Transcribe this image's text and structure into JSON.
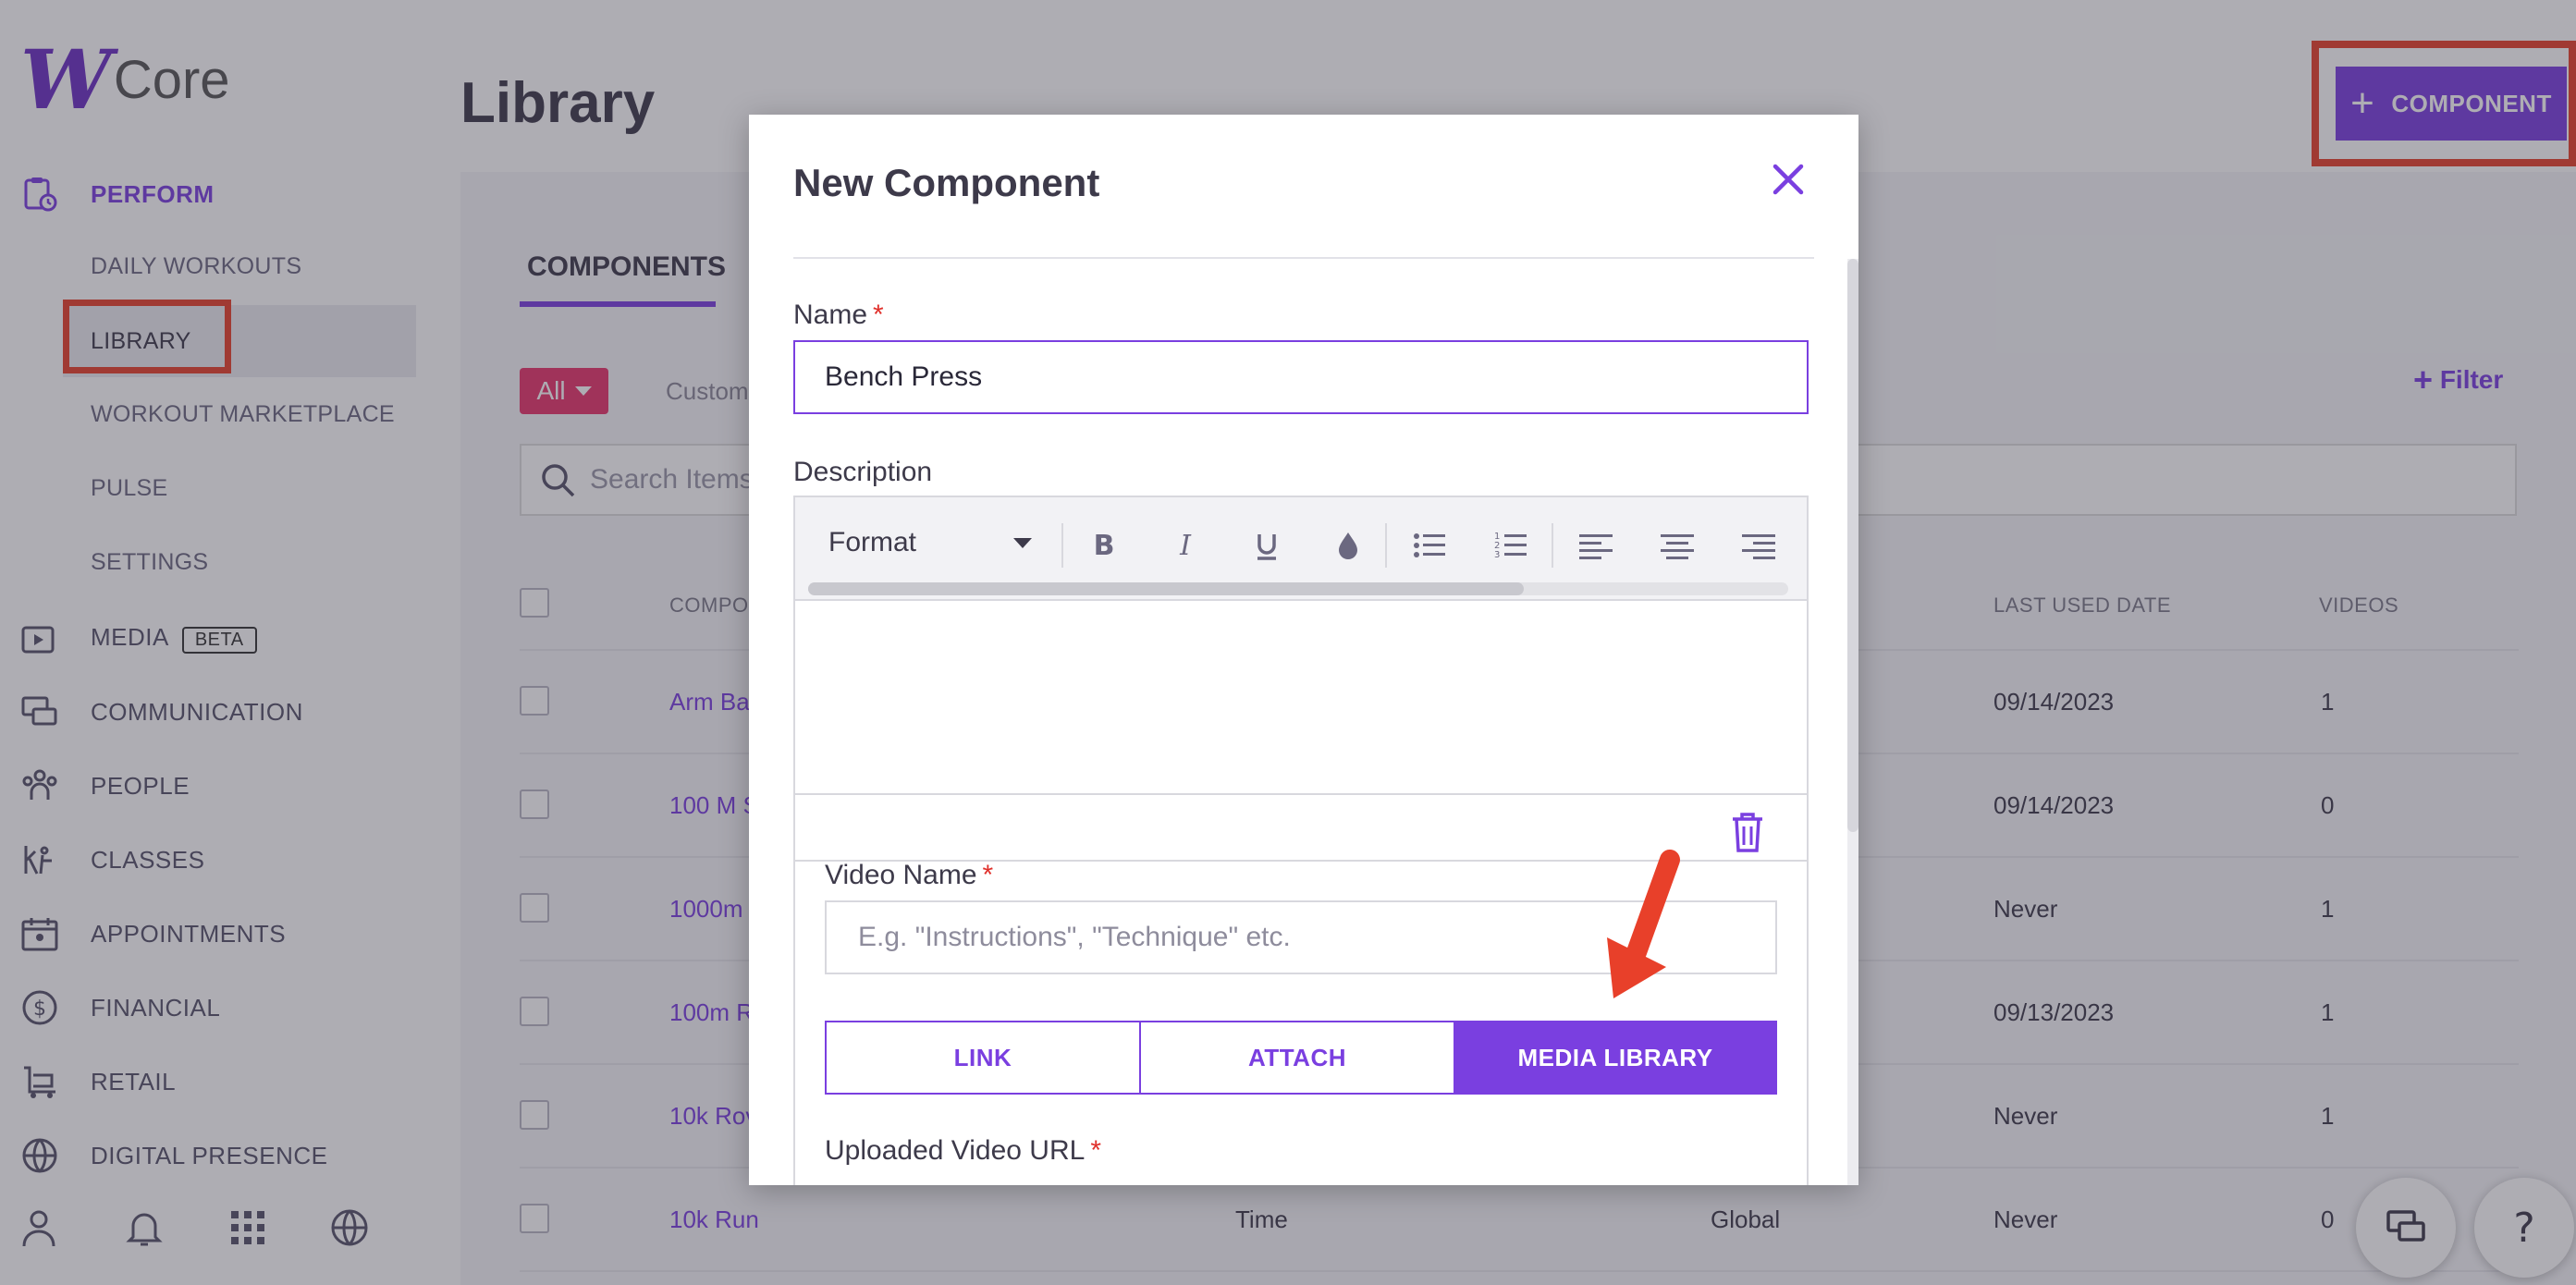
{
  "app": {
    "logo_letter": "W",
    "logo_text": "Core",
    "page_title": "Library"
  },
  "sidebar": {
    "sections": [
      {
        "icon": "clipboard-clock-icon",
        "label": "PERFORM",
        "active": true
      },
      {
        "icon": "media-icon",
        "label": "MEDIA",
        "badge": "BETA"
      },
      {
        "icon": "communication-icon",
        "label": "COMMUNICATION"
      },
      {
        "icon": "people-icon",
        "label": "PEOPLE"
      },
      {
        "icon": "classes-icon",
        "label": "CLASSES"
      },
      {
        "icon": "calendar-icon",
        "label": "APPOINTMENTS"
      },
      {
        "icon": "dollar-icon",
        "label": "FINANCIAL"
      },
      {
        "icon": "cart-icon",
        "label": "RETAIL"
      },
      {
        "icon": "globe-icon",
        "label": "DIGITAL PRESENCE"
      }
    ],
    "sub_items": [
      "DAILY WORKOUTS",
      "LIBRARY",
      "WORKOUT MARKETPLACE",
      "PULSE",
      "SETTINGS"
    ],
    "selected_sub": "LIBRARY",
    "bottom_icons": [
      "user-icon",
      "bell-icon",
      "apps-grid-icon",
      "globe-icon"
    ]
  },
  "header": {
    "add_component_label": "COMPONENT",
    "add_icon": "plus-icon"
  },
  "library": {
    "tab_label": "COMPONENTS",
    "filter_all": "All",
    "custom_label": "Custom",
    "filter_label": "Filter",
    "search_placeholder": "Search Items",
    "columns": [
      "COMPON",
      "LAST USED DATE",
      "VIDEOS"
    ],
    "rows": [
      {
        "name": "Arm Ba",
        "type": "",
        "scope": "",
        "last_used": "09/14/2023",
        "videos": "1"
      },
      {
        "name": "100 M S",
        "type": "",
        "scope": "",
        "last_used": "09/14/2023",
        "videos": "0"
      },
      {
        "name": "1000m",
        "type": "",
        "scope": "",
        "last_used": "Never",
        "videos": "1"
      },
      {
        "name": "100m R",
        "type": "",
        "scope": "",
        "last_used": "09/13/2023",
        "videos": "1"
      },
      {
        "name": "10k Rov",
        "type": "",
        "scope": "",
        "last_used": "Never",
        "videos": "1"
      },
      {
        "name": "10k Run",
        "type": "Time",
        "scope": "Global",
        "last_used": "Never",
        "videos": "0"
      }
    ]
  },
  "modal": {
    "title": "New Component",
    "close_icon": "close-icon",
    "name_label": "Name",
    "required_mark": "*",
    "name_value": "Bench Press",
    "description_label": "Description",
    "toolbar": {
      "format_label": "Format",
      "buttons": [
        "bold-icon",
        "italic-icon",
        "underline-icon",
        "color-drop-icon",
        "bullet-list-icon",
        "numbered-list-icon",
        "align-left-icon",
        "align-center-icon",
        "align-right-icon"
      ]
    },
    "video": {
      "name_label": "Video Name",
      "name_placeholder": "E.g. \"Instructions\", \"Technique\" etc.",
      "source_tabs": [
        "LINK",
        "ATTACH",
        "MEDIA LIBRARY"
      ],
      "active_tab": "MEDIA LIBRARY",
      "url_label": "Uploaded Video URL",
      "delete_icon": "trash-icon"
    }
  },
  "annotations": {
    "highlight_color": "#e8402a",
    "accent_color": "#7a3fe0"
  }
}
